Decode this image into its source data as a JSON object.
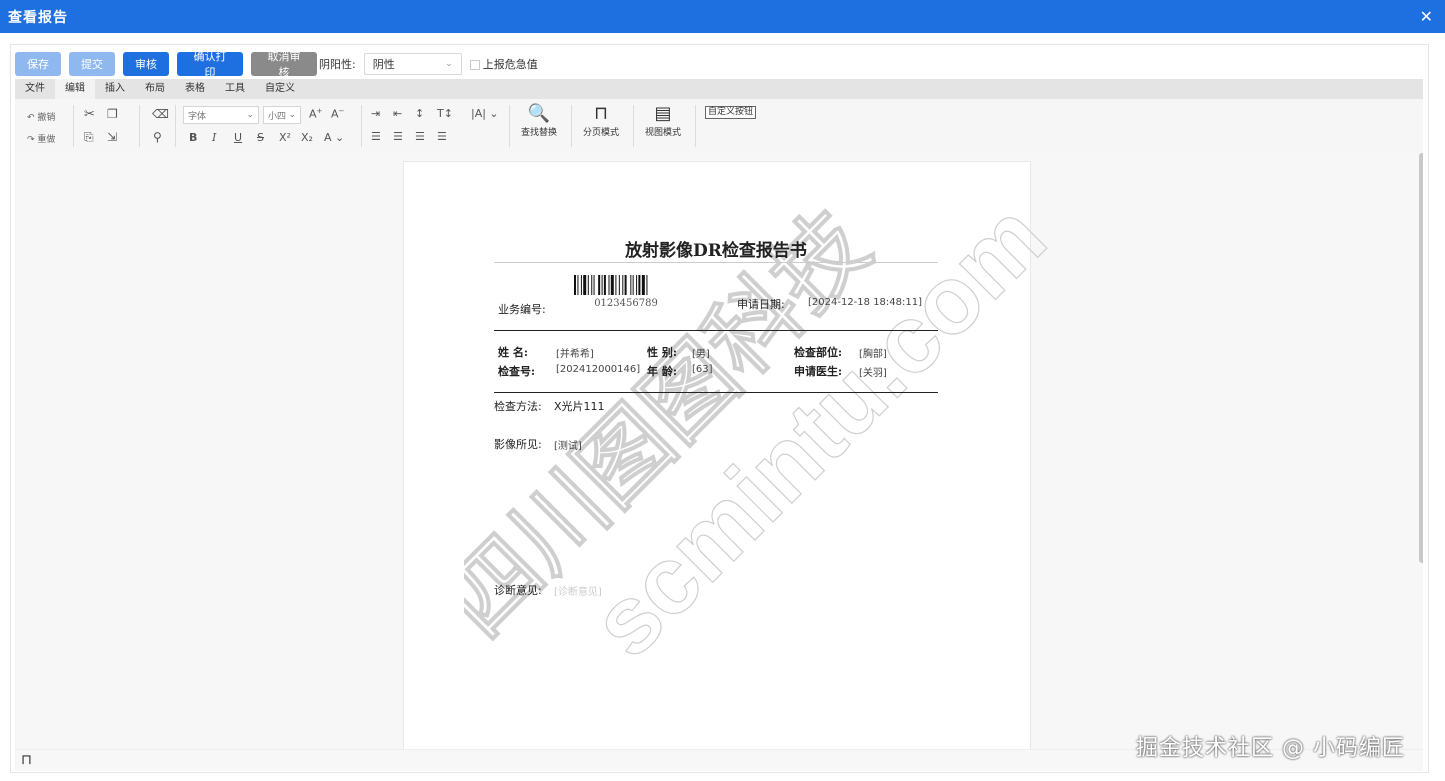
{
  "window": {
    "title": "查看报告",
    "close_icon": "close-icon"
  },
  "actions": {
    "save": "保存",
    "submit": "提交",
    "review": "审核",
    "confirm_print": "确认打印",
    "cancel_review": "取消审核",
    "yinyang_label": "阴阳性:",
    "yinyang_value": "阴性",
    "critical_label": "上报危急值"
  },
  "menu": {
    "tabs": [
      "文件",
      "编辑",
      "插入",
      "布局",
      "表格",
      "工具",
      "自定义"
    ],
    "active": "编辑"
  },
  "ribbon": {
    "undo": "撤销",
    "redo": "重做",
    "font_family": "字体",
    "font_size": "小四",
    "find_replace": "查找替换",
    "page_mode": "分页模式",
    "view_mode": "视图模式",
    "custom_button": "自定义按钮"
  },
  "report": {
    "title": "放射影像DR检查报告书",
    "barcode_number": "0123456789",
    "business_no_label": "业务编号:",
    "apply_date_label": "申请日期:",
    "apply_date_value": "[2024-12-18 18:48:11]",
    "name_label": "姓    名:",
    "name_value": "[并希希]",
    "gender_label": "性  别:",
    "gender_value": "[男]",
    "part_label": "检查部位:",
    "part_value": "[胸部]",
    "exam_no_label": "检查号:",
    "exam_no_value": "[202412000146]",
    "age_label": "年  龄:",
    "age_value": "[63]",
    "doctor_label": "申请医生:",
    "doctor_value": "[关羽]",
    "method_label": "检查方法:",
    "method_value": "X光片111",
    "findings_label": "影像所见:",
    "findings_value": "[测试]",
    "diagnosis_label": "诊断意见:",
    "diagnosis_value": "[诊断意见]"
  },
  "watermark": {
    "line1": "四川图图科技",
    "line2": "scmintu.com"
  },
  "corner_watermark": "掘金技术社区 @ 小码编匠"
}
